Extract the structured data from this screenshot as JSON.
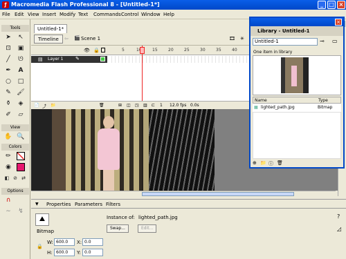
{
  "window": {
    "title": "Macromedia Flash Professional 8 - [Untitled-1*]"
  },
  "menu": [
    "File",
    "Edit",
    "View",
    "Insert",
    "Modify",
    "Text",
    "Commands",
    "Control",
    "Window",
    "Help"
  ],
  "tools": {
    "tools_label": "Tools",
    "view_label": "View",
    "colors_label": "Colors",
    "options_label": "Options"
  },
  "document": {
    "tab": "Untitled-1*",
    "timeline_button": "Timeline",
    "scene": "Scene 1"
  },
  "timeline": {
    "layer_name": "Layer 1",
    "frame_numbers": [
      "1",
      "5",
      "10",
      "15",
      "20",
      "25",
      "30",
      "35",
      "40"
    ],
    "current_frame": "1",
    "fps": "12.0 fps",
    "elapsed": "0.0s"
  },
  "library": {
    "title": "Library - Untitled-1",
    "document_select": "Untitled-1",
    "count": "One item in library",
    "col_name": "Name",
    "col_type": "Type",
    "items": [
      {
        "name": "lighted_path.jpg",
        "type": "Bitmap"
      }
    ]
  },
  "properties": {
    "tabs": [
      "Properties",
      "Parameters",
      "Filters"
    ],
    "object_type": "Bitmap",
    "instance_label": "Instance of:",
    "instance_value": "lighted_path.jpg",
    "swap_button": "Swap...",
    "edit_button": "Edit...",
    "w_label": "W:",
    "w": "600.0",
    "h_label": "H:",
    "h": "600.0",
    "x_label": "X:",
    "x": "0.0",
    "y_label": "Y:",
    "y": "0.0"
  },
  "colors": {
    "accent": "#0048c8",
    "stroke": "#000000",
    "fill": "#e6196e"
  }
}
